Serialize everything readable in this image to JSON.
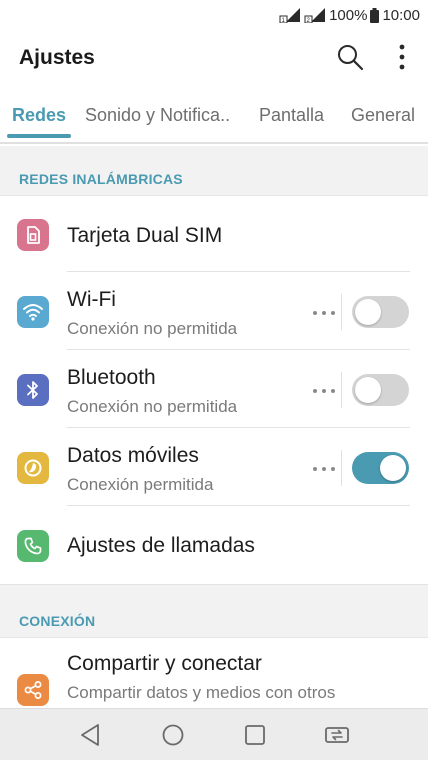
{
  "status_bar": {
    "battery": "100%",
    "time": "10:00",
    "icons": [
      "sim1-signal-icon",
      "sim2-signal-icon",
      "battery-icon"
    ]
  },
  "app_bar": {
    "title": "Ajustes",
    "actions": [
      "search-icon",
      "more-vert-icon"
    ]
  },
  "tabs": [
    {
      "label": "Redes",
      "active": true
    },
    {
      "label": "Sonido y Notifica..",
      "active": false
    },
    {
      "label": "Pantalla",
      "active": false
    },
    {
      "label": "General",
      "active": false
    }
  ],
  "sections": {
    "wireless": {
      "header": "REDES INALÁMBRICAS",
      "items": [
        {
          "title": "Tarjeta Dual SIM",
          "icon": "dual-sim-icon",
          "icon_color": "#d9748f"
        },
        {
          "title": "Wi-Fi",
          "subtitle": "Conexión no permitida",
          "icon": "wifi-icon",
          "icon_color": "#5aa9d0",
          "toggle": false
        },
        {
          "title": "Bluetooth",
          "subtitle": "Conexión no permitida",
          "icon": "bluetooth-icon",
          "icon_color": "#5a6fbf",
          "toggle": false
        },
        {
          "title": "Datos móviles",
          "subtitle": "Conexión permitida",
          "icon": "mobile-data-icon",
          "icon_color": "#e4b83f",
          "toggle": true
        },
        {
          "title": "Ajustes de llamadas",
          "icon": "phone-icon",
          "icon_color": "#57b870"
        }
      ]
    },
    "connection": {
      "header": "CONEXIÓN",
      "items": [
        {
          "title": "Compartir y conectar",
          "subtitle": "Compartir datos y medios con otros",
          "icon": "share-icon",
          "icon_color": "#ea8a43"
        }
      ]
    }
  },
  "nav_bar": [
    "back-icon",
    "home-icon",
    "recents-icon",
    "dual-window-icon"
  ],
  "colors": {
    "accent": "#4a9ab1",
    "toggle_off": "#d4d4d4",
    "section_bg": "#f2f2f2"
  }
}
